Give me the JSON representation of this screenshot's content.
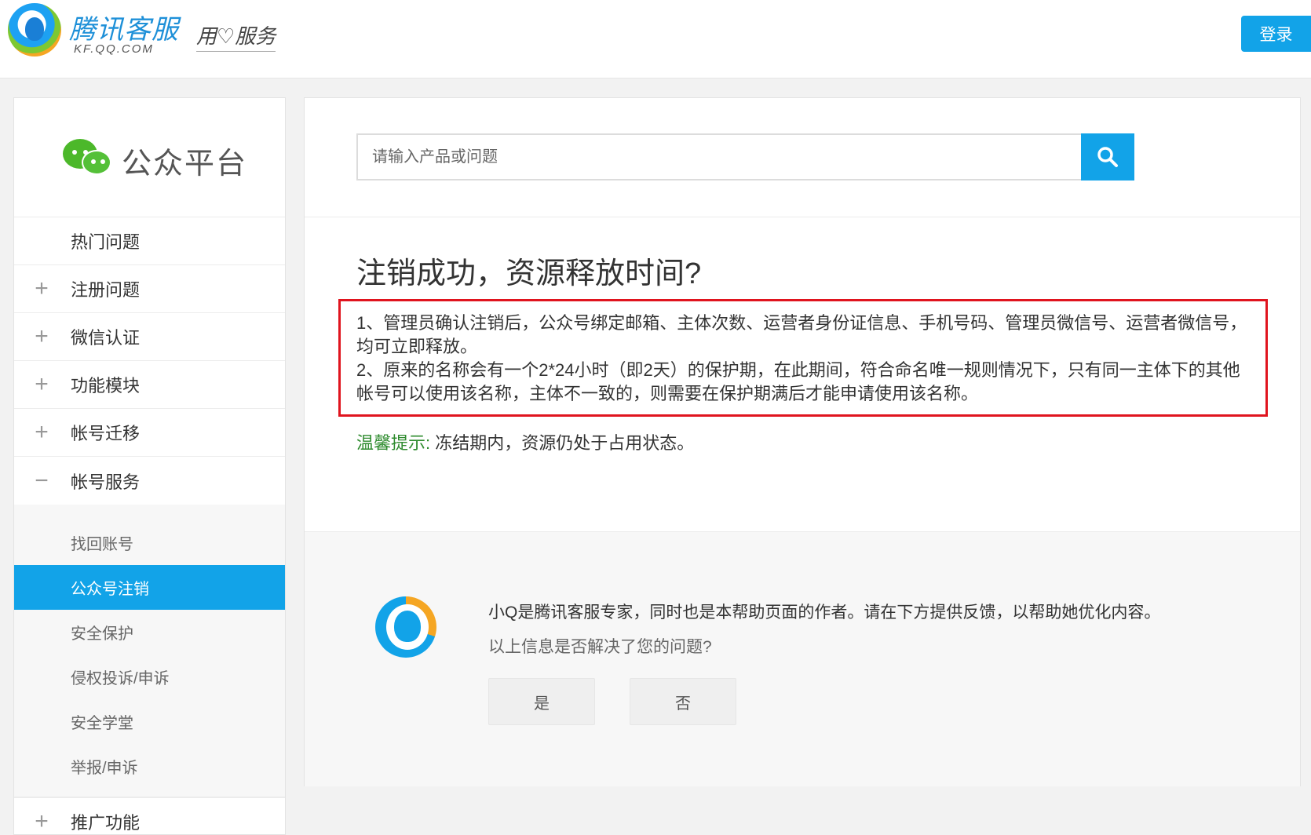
{
  "header": {
    "logo_text": "腾讯客服",
    "logo_sub": "KF.QQ.COM",
    "slogan": "用♡服务",
    "login_label": "登录"
  },
  "sidebar": {
    "brand": "公众平台",
    "items": [
      {
        "sign": "",
        "label": "热门问题"
      },
      {
        "sign": "+",
        "label": "注册问题"
      },
      {
        "sign": "+",
        "label": "微信认证"
      },
      {
        "sign": "+",
        "label": "功能模块"
      },
      {
        "sign": "+",
        "label": "帐号迁移"
      },
      {
        "sign": "−",
        "label": "帐号服务"
      }
    ],
    "sub_items": [
      {
        "label": "找回账号",
        "active": false
      },
      {
        "label": "公众号注销",
        "active": true
      },
      {
        "label": "安全保护",
        "active": false
      },
      {
        "label": "侵权投诉/申诉",
        "active": false
      },
      {
        "label": "安全学堂",
        "active": false
      },
      {
        "label": "举报/申诉",
        "active": false
      }
    ],
    "bottom_item": {
      "sign": "+",
      "label": "推广功能"
    }
  },
  "search": {
    "placeholder": "请输入产品或问题"
  },
  "article": {
    "title": "注销成功，资源释放时间?",
    "para1": "1、管理员确认注销后，公众号绑定邮箱、主体次数、运营者身份证信息、手机号码、管理员微信号、运营者微信号，均可立即释放。",
    "para2": "2、原来的名称会有一个2*24小时（即2天）的保护期，在此期间，符合命名唯一规则情况下，只有同一主体下的其他帐号可以使用该名称，主体不一致的，则需要在保护期满后才能申请使用该名称。",
    "tip_label": "温馨提示:",
    "tip_text": " 冻结期内，资源仍处于占用状态。"
  },
  "feedback": {
    "intro": "小Q是腾讯客服专家，同时也是本帮助页面的作者。请在下方提供反馈，以帮助她优化内容。",
    "question": "以上信息是否解决了您的问题?",
    "yes_label": "是",
    "no_label": "否"
  },
  "colors": {
    "accent": "#12a3e8",
    "highlight_border": "#e0141e",
    "tip_green": "#2e8b2e",
    "wechat_green": "#4cb82a"
  }
}
